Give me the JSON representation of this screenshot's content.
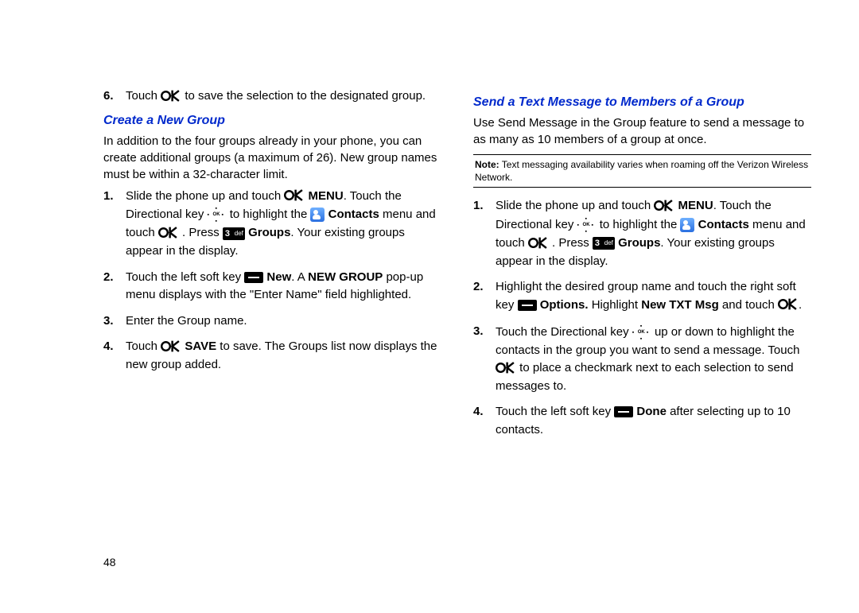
{
  "left": {
    "step6": {
      "a": "Touch ",
      "b": " to save the selection to the designated group."
    },
    "heading": "Create a New Group",
    "intro": "In addition to the four groups already in your phone, you can create additional groups (a maximum of 26). New group names must be within a 32-character limit.",
    "steps": {
      "1": {
        "a": "Slide the phone up and touch ",
        "menu": "MENU",
        "b": ". Touch the Directional key ",
        "c": " to highlight the ",
        "contacts": "Contacts",
        "d": " menu and touch ",
        "e": ". Press ",
        "groups": "Groups",
        "f": ". Your existing groups appear in the display."
      },
      "2": {
        "a": "Touch the left soft key ",
        "new": "New",
        "b": ". A ",
        "popup": "NEW GROUP",
        "c": " pop-up menu displays with the \"Enter Name\" field highlighted."
      },
      "3": "Enter the Group name.",
      "4": {
        "a": "Touch ",
        "save": "SAVE",
        "b": " to save. The Groups list now displays the new group added."
      }
    }
  },
  "right": {
    "heading": "Send a Text Message to Members of a Group",
    "intro": "Use Send Message in the Group feature to send a message to as many as 10 members of a group at once.",
    "note_label": "Note:",
    "note": " Text messaging availability varies when roaming off the Verizon Wireless Network.",
    "steps": {
      "1": {
        "a": "Slide the phone up and touch ",
        "menu": "MENU",
        "b": ". Touch the Directional key ",
        "c": " to highlight the ",
        "contacts": "Contacts",
        "d": " menu and touch ",
        "e": ". Press ",
        "groups": "Groups",
        "f": ". Your existing groups appear in the display."
      },
      "2": {
        "a": "Highlight the desired group name and touch the right soft key ",
        "options": "Options.",
        "b": " Highlight ",
        "newtxt": "New TXT Msg",
        "c": " and touch ",
        "d": "."
      },
      "3": {
        "a": "Touch the Directional key ",
        "b": " up or down to highlight the contacts in the group you want to send a message. Touch ",
        "c": " to place a checkmark next to each selection to send messages to."
      },
      "4": {
        "a": "Touch the left soft key ",
        "done": "Done",
        "b": " after selecting up to 10 contacts."
      }
    }
  },
  "icons": {
    "def_label": "def"
  },
  "page": "48"
}
